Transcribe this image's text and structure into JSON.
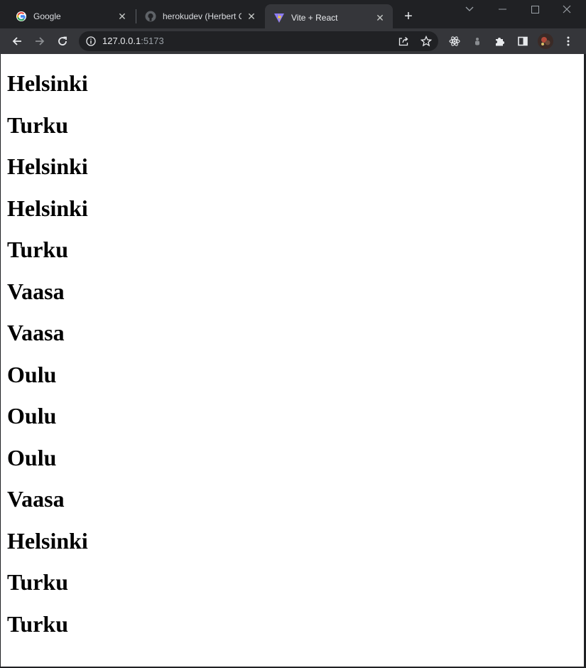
{
  "browser": {
    "tabs": [
      {
        "title": "Google",
        "favicon": "google-icon",
        "active": false
      },
      {
        "title": "herokudev (Herbert O",
        "favicon": "github-icon",
        "active": false
      },
      {
        "title": "Vite + React",
        "favicon": "vite-icon",
        "active": true
      }
    ],
    "address": {
      "host": "127.0.0.1",
      "port": ":5173"
    }
  },
  "page": {
    "cities": [
      "Helsinki",
      "Turku",
      "Helsinki",
      "Helsinki",
      "Turku",
      "Vaasa",
      "Vaasa",
      "Oulu",
      "Oulu",
      "Oulu",
      "Vaasa",
      "Helsinki",
      "Turku",
      "Turku"
    ]
  },
  "colors": {
    "frame": "#202124",
    "toolbar": "#35363a",
    "page_bg": "#ffffff",
    "text": "#000000"
  }
}
